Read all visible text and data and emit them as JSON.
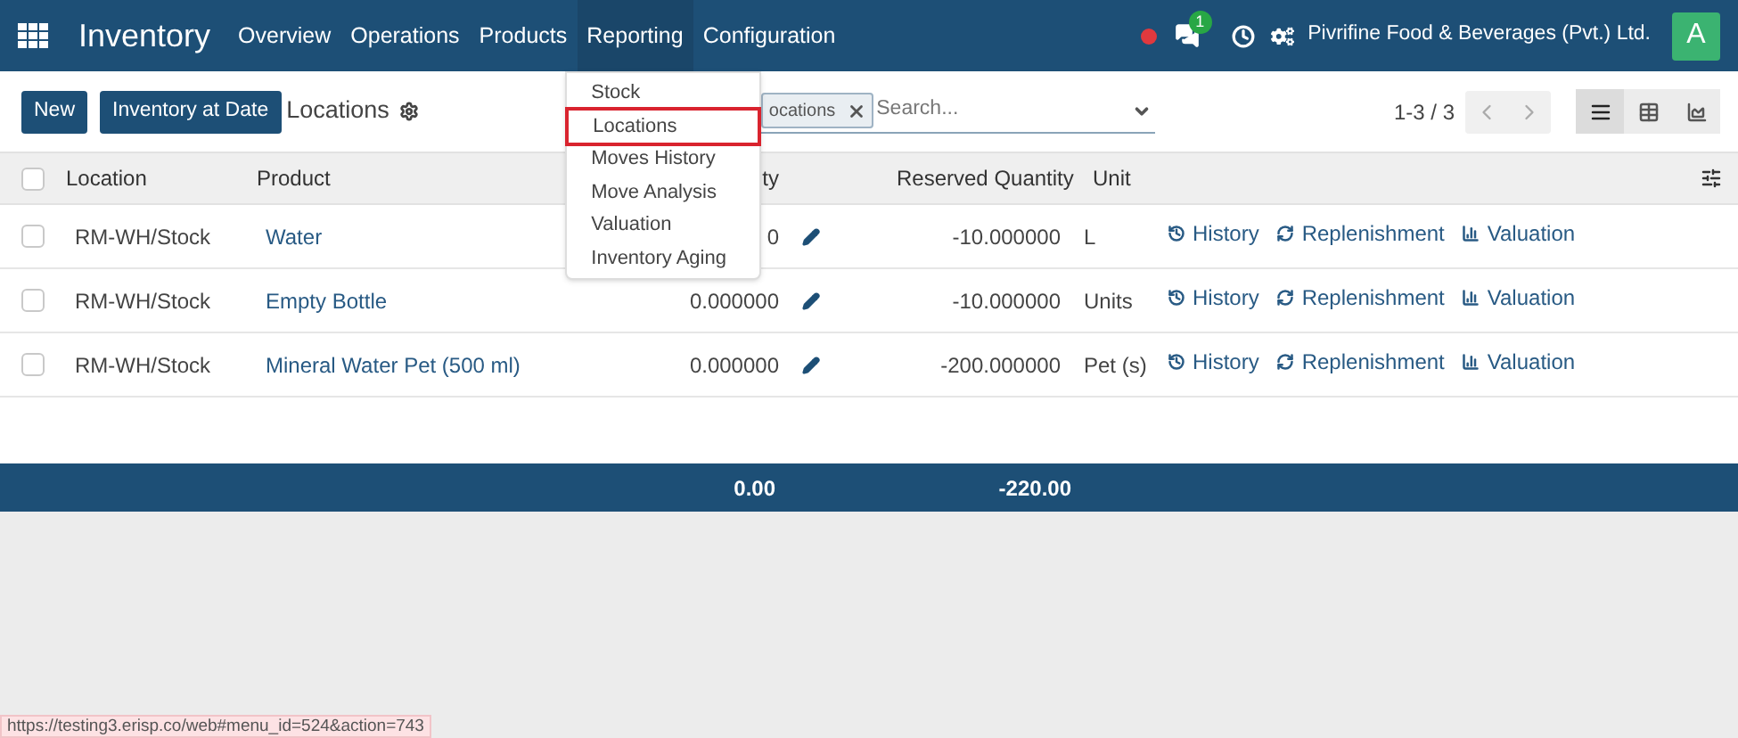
{
  "navbar": {
    "app_name": "Inventory",
    "company": "Pivrifine Food & Beverages (Pvt.) Ltd.",
    "avatar": "A",
    "chat_badge": "1",
    "menu": [
      {
        "label": "Overview",
        "expanded": false
      },
      {
        "label": "Operations",
        "expanded": false
      },
      {
        "label": "Products",
        "expanded": false
      },
      {
        "label": "Reporting",
        "expanded": true,
        "items": [
          {
            "label": "Stock",
            "selected": false
          },
          {
            "label": "Locations",
            "selected": true
          },
          {
            "label": "Moves History",
            "selected": false
          },
          {
            "label": "Move Analysis",
            "selected": false
          },
          {
            "label": "Valuation",
            "selected": false
          },
          {
            "label": "Inventory Aging",
            "selected": false
          }
        ]
      },
      {
        "label": "Configuration",
        "expanded": false
      }
    ]
  },
  "control_panel": {
    "buttons": [
      "New",
      "Inventory at Date"
    ],
    "breadcrumb": "Locations",
    "search": {
      "facet": "ocations",
      "placeholder": "Search..."
    },
    "pager": "1-3 / 3",
    "views": [
      {
        "kind": "list",
        "selected": true
      },
      {
        "kind": "pivot",
        "selected": false
      },
      {
        "kind": "graph",
        "selected": false
      }
    ]
  },
  "table": {
    "select_all": {
      "checked": false
    },
    "columns": [
      "Location",
      "Product",
      "ty",
      "Reserved Quantity",
      "Unit"
    ],
    "rows": [
      {
        "checked": false,
        "location": "RM-WH/Stock",
        "product": "Water",
        "quantity": "0",
        "reserved": "-10.000000",
        "unit": "L",
        "actions": [
          "History",
          "Replenishment",
          "Valuation"
        ]
      },
      {
        "checked": false,
        "location": "RM-WH/Stock",
        "product": "Empty Bottle",
        "quantity": "0.000000",
        "reserved": "-10.000000",
        "unit": "Units",
        "actions": [
          "History",
          "Replenishment",
          "Valuation"
        ]
      },
      {
        "checked": false,
        "location": "RM-WH/Stock",
        "product": "Mineral Water Pet (500 ml)",
        "quantity": "0.000000",
        "reserved": "-200.000000",
        "unit": "Pet (s)",
        "actions": [
          "History",
          "Replenishment",
          "Valuation"
        ]
      }
    ],
    "totals": {
      "quantity": "0.00",
      "reserved": "-220.00"
    }
  },
  "status_url": "https://testing3.erisp.co/web#menu_id=524&action=743"
}
